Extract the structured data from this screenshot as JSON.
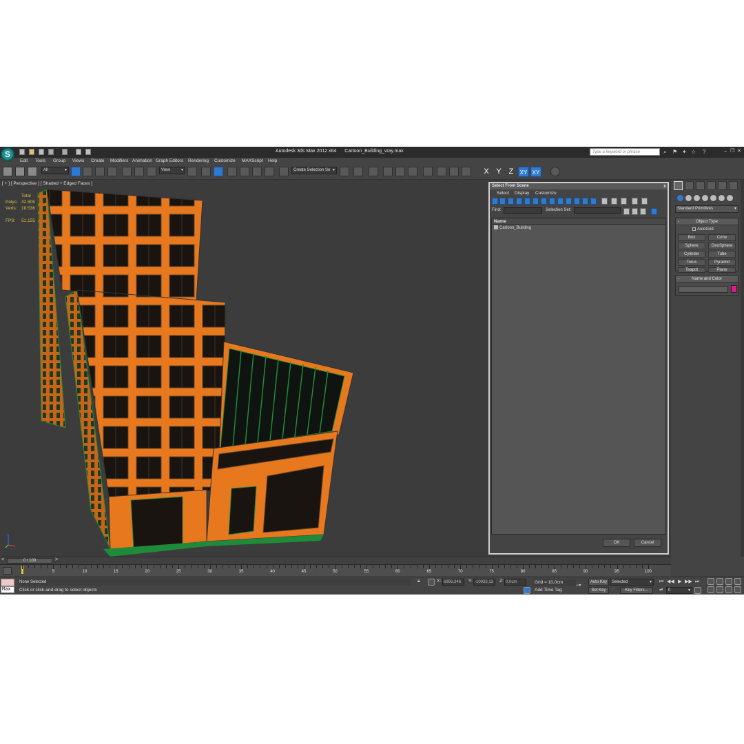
{
  "window": {
    "app_title": "Autodesk 3ds Max  2012 x64",
    "file_title": "Cartoon_Building_vray.max",
    "search_placeholder": "Type a keyword or phrase",
    "logo_glyph": "S"
  },
  "menubar": [
    "Edit",
    "Tools",
    "Group",
    "Views",
    "Create",
    "Modifiers",
    "Animation",
    "Graph Editors",
    "Rendering",
    "Customize",
    "MAXScript",
    "Help"
  ],
  "toolbar": {
    "filter_value": "All",
    "refcoord_value": "View",
    "selection_set_value": "Create Selection Se",
    "axis_x": "X",
    "axis_y": "Y",
    "axis_z": "Z",
    "axis_xy": "XY",
    "axis_xy2": "XY"
  },
  "viewport": {
    "label": "[ + ] [ Perspective ] [ Shaded + Edged Faces ]",
    "stats_total_label": "Total",
    "polys_label": "Polys:",
    "polys_value": "32 805",
    "verts_label": "Verts:",
    "verts_value": "18 536",
    "fps_label": "FPS:",
    "fps_value": "51,155"
  },
  "dialog": {
    "title": "Select From Scene",
    "close_glyph": "x",
    "menus": [
      "Select",
      "Display",
      "Customize"
    ],
    "find_label": "Find:",
    "selection_set_label": "Selection Set:",
    "column_name": "Name",
    "items": [
      "Cartoon_Building"
    ],
    "ok_label": "OK",
    "cancel_label": "Cancel"
  },
  "command_panel": {
    "category": "Standard Primitives",
    "object_type_header": "Object Type",
    "autogrid_label": "AutoGrid",
    "object_buttons": [
      "Box",
      "Cone",
      "Sphere",
      "GeoSphere",
      "Cylinder",
      "Tube",
      "Torus",
      "Pyramid",
      "Teapot",
      "Plane"
    ],
    "name_color_header": "Name and Color",
    "rollout_toggle": "-",
    "swatch_color": "#e0188a"
  },
  "timeline": {
    "slider_label": "0 / 100",
    "left_arrow": "<",
    "right_arrow": ">",
    "ticks": [
      "0",
      "5",
      "10",
      "15",
      "20",
      "25",
      "30",
      "35",
      "40",
      "45",
      "50",
      "55",
      "60",
      "65",
      "70",
      "75",
      "80",
      "85",
      "90",
      "95",
      "100"
    ]
  },
  "statusbar": {
    "maxscript_label": "Max",
    "selection_status": "None Selected",
    "prompt": "Click or click-and-drag to select objects",
    "x_label": "X:",
    "x_value": "6956,346",
    "y_label": "Y:",
    "y_value": "-10033,13",
    "z_label": "Z:",
    "z_value": "0,0cm",
    "grid": "Grid = 10,0cm",
    "add_time_tag": "Add Time Tag",
    "auto_key": "Auto Key",
    "set_key": "Set Key",
    "key_mode": "Selected",
    "key_filters": "Key Filters...",
    "current_frame": "0"
  },
  "colors": {
    "building_orange": "#e8781e",
    "window_dark": "#1a1410",
    "edge_green": "#1e8a3a",
    "highlight_blue": "#2f7ad0"
  }
}
